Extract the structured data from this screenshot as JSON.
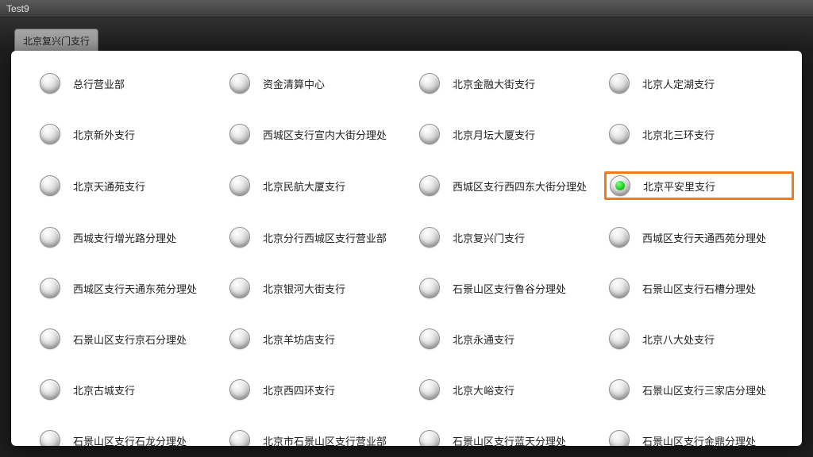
{
  "window": {
    "title": "Test9"
  },
  "behind_button_label": "北京复兴门支行",
  "selected_index": 11,
  "options": [
    "总行营业部",
    "资金清算中心",
    "北京金融大街支行",
    "北京人定湖支行",
    "北京新外支行",
    "西城区支行宣内大街分理处",
    "北京月坛大厦支行",
    "北京北三环支行",
    "北京天通苑支行",
    "北京民航大厦支行",
    "西城区支行西四东大街分理处",
    "北京平安里支行",
    "西城支行增光路分理处",
    "北京分行西城区支行营业部",
    "北京复兴门支行",
    "西城区支行天通西苑分理处",
    "西城区支行天通东苑分理处",
    "北京银河大街支行",
    "石景山区支行鲁谷分理处",
    "石景山区支行石槽分理处",
    "石景山区支行京石分理处",
    "北京羊坊店支行",
    "北京永通支行",
    "北京八大处支行",
    "北京古城支行",
    "北京西四环支行",
    "北京大峪支行",
    "石景山区支行三家店分理处",
    "石景山区支行石龙分理处",
    "北京市石景山区支行营业部",
    "石景山区支行蓝天分理处",
    "石景山区支行金鼎分理处"
  ]
}
